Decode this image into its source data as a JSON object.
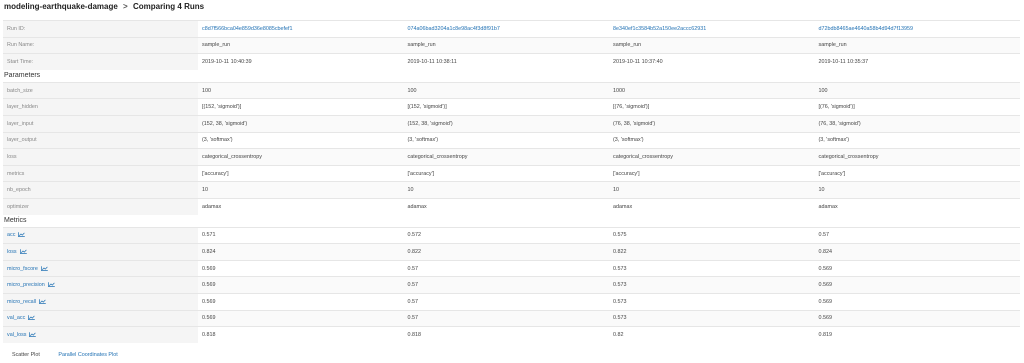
{
  "header": {
    "experiment": "modeling-earthquake-damage",
    "separator": ">",
    "title": "Comparing 4 Runs"
  },
  "runs": {
    "labels": {
      "id": "Run ID:",
      "name": "Run Name:",
      "start": "Start Time:"
    },
    "ids": [
      "c8d7f566bca04e859d36e8085cbefef1",
      "074a06bad3204a1c8e98ac4f3d8f91b7",
      "8e340ef1c3584b52a150ee2accc62931",
      "d72bdb8465ae4640a58b4d94d7f13959"
    ],
    "names": [
      "sample_run",
      "sample_run",
      "sample_run",
      "sample_run"
    ],
    "start_times": [
      "2019-10-11 10:40:39",
      "2019-10-11 10:38:11",
      "2019-10-11 10:37:40",
      "2019-10-11 10:35:37"
    ]
  },
  "parameters": {
    "section_title": "Parameters",
    "rows": [
      {
        "name": "batch_size",
        "values": [
          "100",
          "100",
          "1000",
          "100"
        ]
      },
      {
        "name": "layer_hidden",
        "values": [
          "[(152, 'sigmoid')]",
          "[(152, 'sigmoid')]",
          "[(76, 'sigmoid')]",
          "[(76, 'sigmoid')]"
        ]
      },
      {
        "name": "layer_input",
        "values": [
          "(152, 38, 'sigmoid')",
          "(152, 38, 'sigmoid')",
          "(76, 38, 'sigmoid')",
          "(76, 38, 'sigmoid')"
        ]
      },
      {
        "name": "layer_output",
        "values": [
          "(3, 'softmax')",
          "(3, 'softmax')",
          "(3, 'softmax')",
          "(3, 'softmax')"
        ]
      },
      {
        "name": "loss",
        "values": [
          "categorical_crossentropy",
          "categorical_crossentropy",
          "categorical_crossentropy",
          "categorical_crossentropy"
        ]
      },
      {
        "name": "metrics",
        "values": [
          "['accuracy']",
          "['accuracy']",
          "['accuracy']",
          "['accuracy']"
        ]
      },
      {
        "name": "nb_epoch",
        "values": [
          "10",
          "10",
          "10",
          "10"
        ]
      },
      {
        "name": "optimizer",
        "values": [
          "adamax",
          "adamax",
          "adamax",
          "adamax"
        ]
      }
    ]
  },
  "metrics": {
    "section_title": "Metrics",
    "rows": [
      {
        "name": "acc",
        "values": [
          "0.571",
          "0.572",
          "0.575",
          "0.57"
        ]
      },
      {
        "name": "loss",
        "values": [
          "0.824",
          "0.822",
          "0.822",
          "0.824"
        ]
      },
      {
        "name": "micro_fscore",
        "values": [
          "0.569",
          "0.57",
          "0.573",
          "0.569"
        ]
      },
      {
        "name": "micro_precision",
        "values": [
          "0.569",
          "0.57",
          "0.573",
          "0.569"
        ]
      },
      {
        "name": "micro_recall",
        "values": [
          "0.569",
          "0.57",
          "0.573",
          "0.569"
        ]
      },
      {
        "name": "val_acc",
        "values": [
          "0.569",
          "0.57",
          "0.573",
          "0.569"
        ]
      },
      {
        "name": "val_loss",
        "values": [
          "0.818",
          "0.818",
          "0.82",
          "0.819"
        ]
      }
    ]
  },
  "tabs": {
    "scatter": "Scatter Plot",
    "parallel": "Parallel Coordinates Plot"
  },
  "colors": {
    "link": "#2272b4",
    "label_bg": "#f5f5f5",
    "border": "#e6e6e6"
  },
  "icons": {
    "metric_chart": "line-chart-icon"
  }
}
